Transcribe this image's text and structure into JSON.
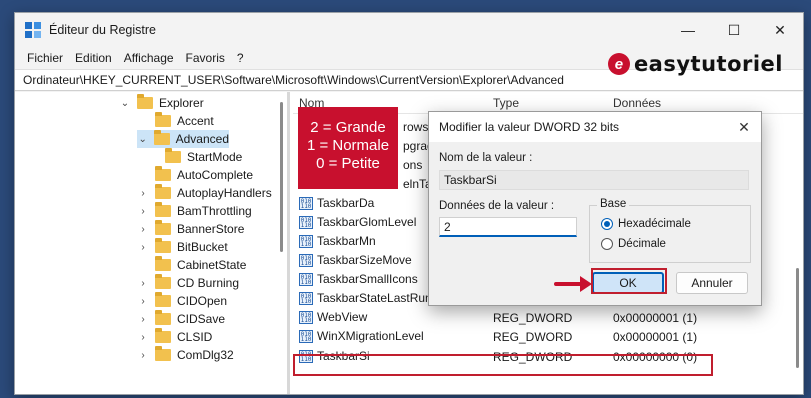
{
  "window": {
    "title": "Éditeur du Registre",
    "controls": [
      "—",
      "☐",
      "✕"
    ]
  },
  "menu": [
    "Fichier",
    "Edition",
    "Affichage",
    "Favoris",
    "?"
  ],
  "brand": "easytutoriel",
  "address": "Ordinateur\\HKEY_CURRENT_USER\\Software\\Microsoft\\Windows\\CurrentVersion\\Explorer\\Advanced",
  "tree": [
    {
      "label": "Explorer",
      "chev": "v"
    },
    {
      "label": "Accent",
      "chev": ""
    },
    {
      "label": "Advanced",
      "chev": "v"
    },
    {
      "label": "StartMode",
      "chev": ""
    },
    {
      "label": "AutoComplete",
      "chev": ""
    },
    {
      "label": "AutoplayHandlers",
      "chev": ">"
    },
    {
      "label": "BamThrottling",
      "chev": ">"
    },
    {
      "label": "BannerStore",
      "chev": ">"
    },
    {
      "label": "BitBucket",
      "chev": ">"
    },
    {
      "label": "CabinetState",
      "chev": ""
    },
    {
      "label": "CD Burning",
      "chev": ">"
    },
    {
      "label": "CIDOpen",
      "chev": ">"
    },
    {
      "label": "CIDSave",
      "chev": ">"
    },
    {
      "label": "CLSID",
      "chev": ">"
    },
    {
      "label": "ComDlg32",
      "chev": ">"
    }
  ],
  "list": {
    "headers": {
      "name": "Nom",
      "type": "Type",
      "data": "Données"
    },
    "partial": [
      "rowser",
      "pgrad",
      "ons",
      "elnTab"
    ],
    "rows": [
      {
        "name": "TaskbarDa",
        "type": "",
        "data": ""
      },
      {
        "name": "TaskbarGlomLevel",
        "type": "",
        "data": ""
      },
      {
        "name": "TaskbarMn",
        "type": "",
        "data": ""
      },
      {
        "name": "TaskbarSizeMove",
        "type": "",
        "data": ""
      },
      {
        "name": "TaskbarSmallIcons",
        "type": "",
        "data": ""
      },
      {
        "name": "TaskbarStateLastRun",
        "type": "",
        "data": ""
      },
      {
        "name": "WebView",
        "type": "REG_DWORD",
        "data": "0x00000001 (1)"
      },
      {
        "name": "WinXMigrationLevel",
        "type": "REG_DWORD",
        "data": "0x00000001 (1)"
      },
      {
        "name": "TaskbarSi",
        "type": "REG_DWORD",
        "data": "0x00000000 (0)"
      }
    ]
  },
  "callout": [
    "2 = Grande",
    "1 = Normale",
    "0 = Petite"
  ],
  "dialog": {
    "title": "Modifier la valeur DWORD 32 bits",
    "name_label": "Nom de la valeur :",
    "name_value": "TaskbarSi",
    "data_label": "Données de la valeur :",
    "data_value": "2",
    "base_label": "Base",
    "radio_hex": "Hexadécimale",
    "radio_dec": "Décimale",
    "ok": "OK",
    "cancel": "Annuler"
  },
  "colors": {
    "accent": "#005fb8",
    "highlight": "#c01e2e",
    "callout": "#c8102e"
  }
}
